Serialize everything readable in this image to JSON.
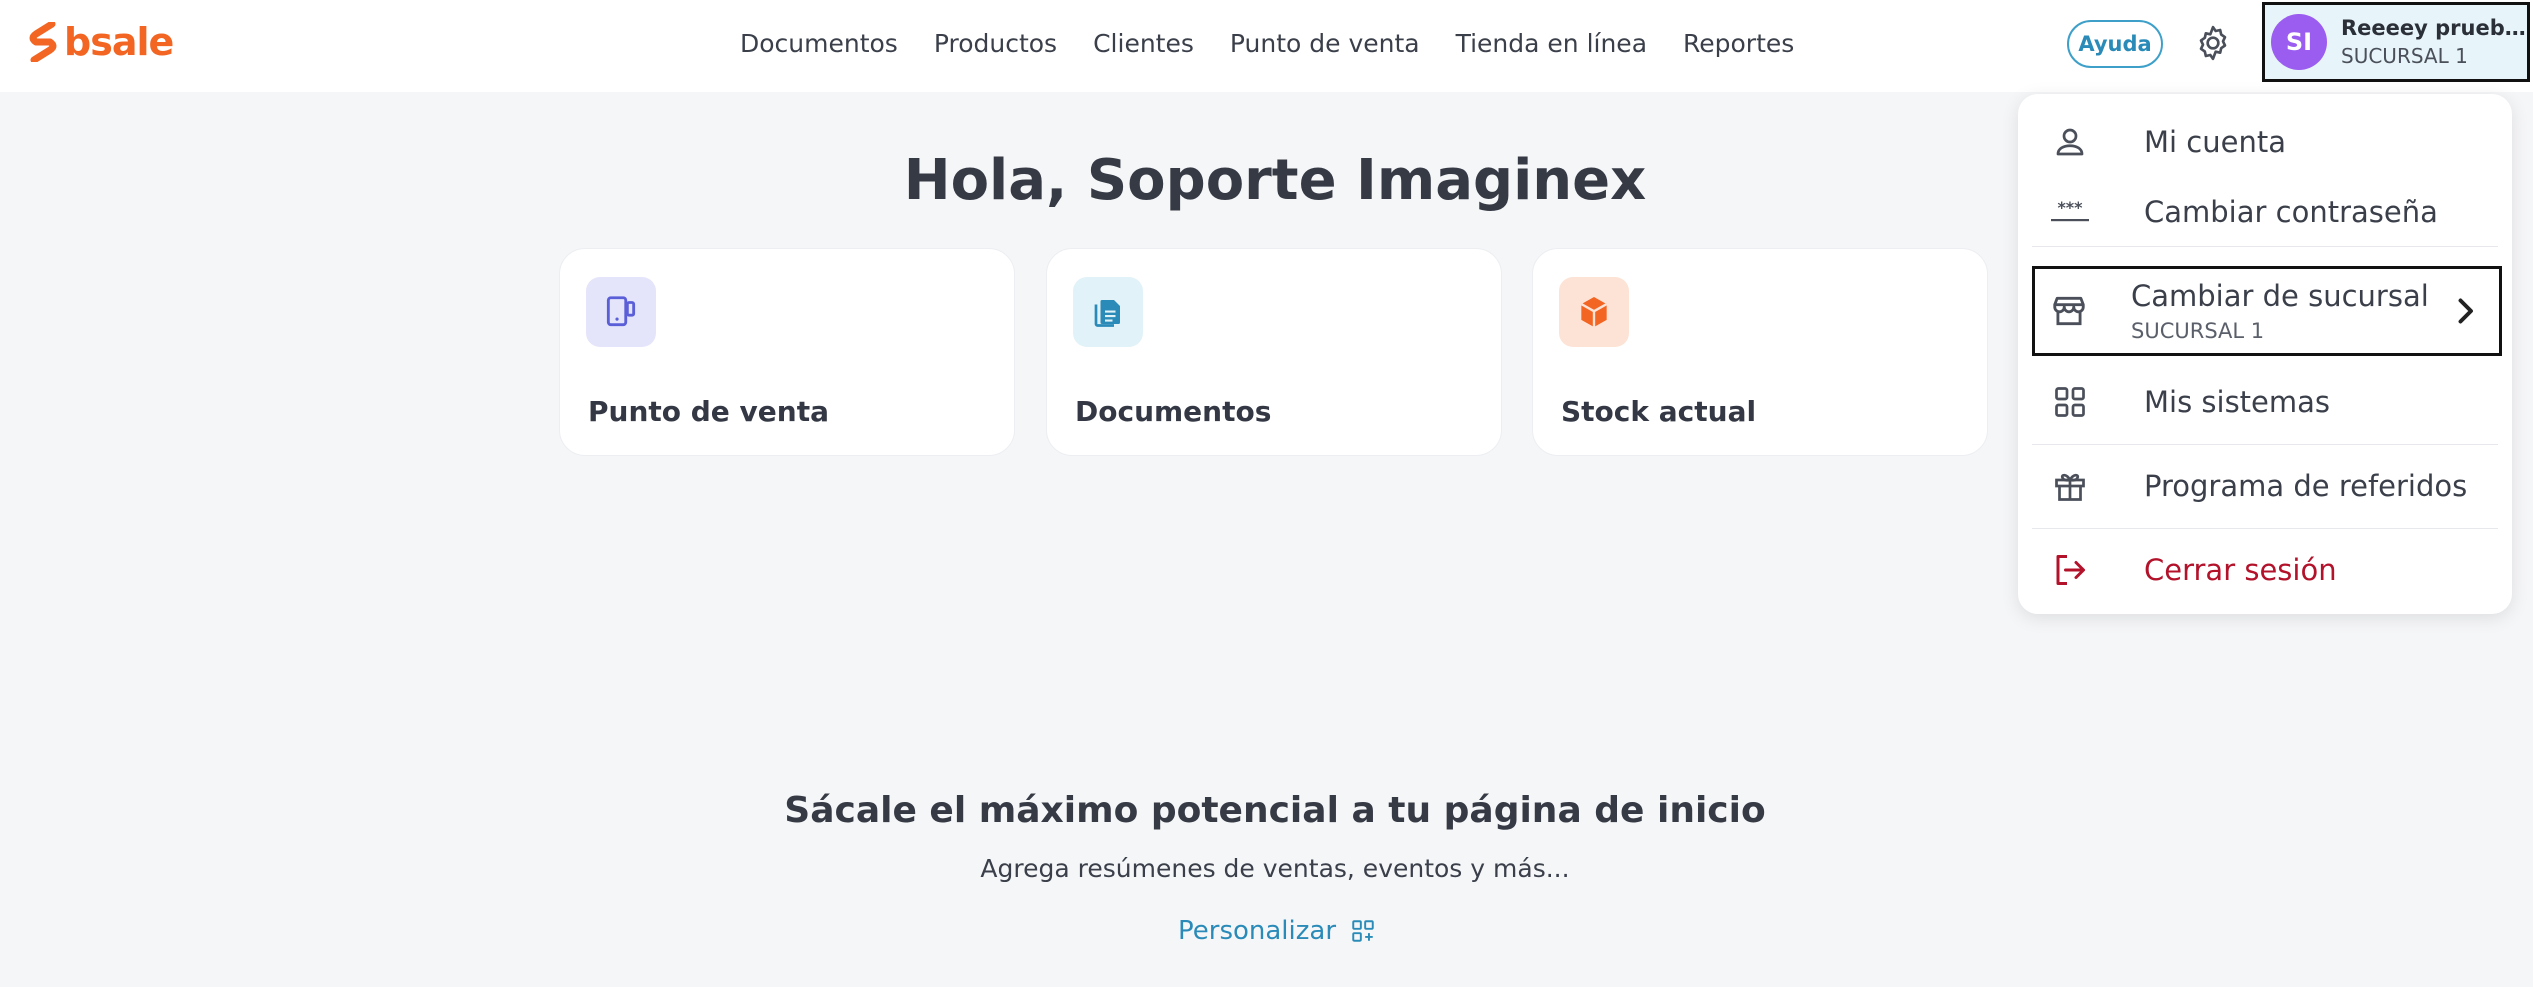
{
  "header": {
    "logo_text": "bsale",
    "nav": [
      "Documentos",
      "Productos",
      "Clientes",
      "Punto de venta",
      "Tienda en línea",
      "Reportes"
    ],
    "help_label": "Ayuda",
    "user": {
      "initials": "SI",
      "name": "Reeeey prueb...",
      "branch": "SUCURSAL 1"
    }
  },
  "main": {
    "greeting": "Hola, Soporte Imaginex",
    "cards": [
      {
        "title": "Punto de venta",
        "icon": "tablet-icon",
        "color": "#5a5fd8",
        "bg": "#e4e4fb"
      },
      {
        "title": "Documentos",
        "icon": "document-icon",
        "color": "#2a8bb8",
        "bg": "#e1f2f8"
      },
      {
        "title": "Stock actual",
        "icon": "box-icon",
        "color": "#f26522",
        "bg": "#fde3d6"
      }
    ],
    "promo_title": "Sácale el máximo potencial a tu página de inicio",
    "promo_subtitle": "Agrega resúmenes de ventas, eventos y más...",
    "personalize_label": "Personalizar"
  },
  "dropdown": {
    "my_account": "Mi cuenta",
    "change_password": "Cambiar contraseña",
    "change_branch": "Cambiar de sucursal",
    "current_branch": "SUCURSAL 1",
    "my_systems": "Mis sistemas",
    "referrals": "Programa de referidos",
    "logout": "Cerrar sesión"
  },
  "colors": {
    "brand": "#f26522",
    "accent": "#2a8bb8",
    "avatar": "#9b5cf0",
    "danger": "#b3122b"
  }
}
